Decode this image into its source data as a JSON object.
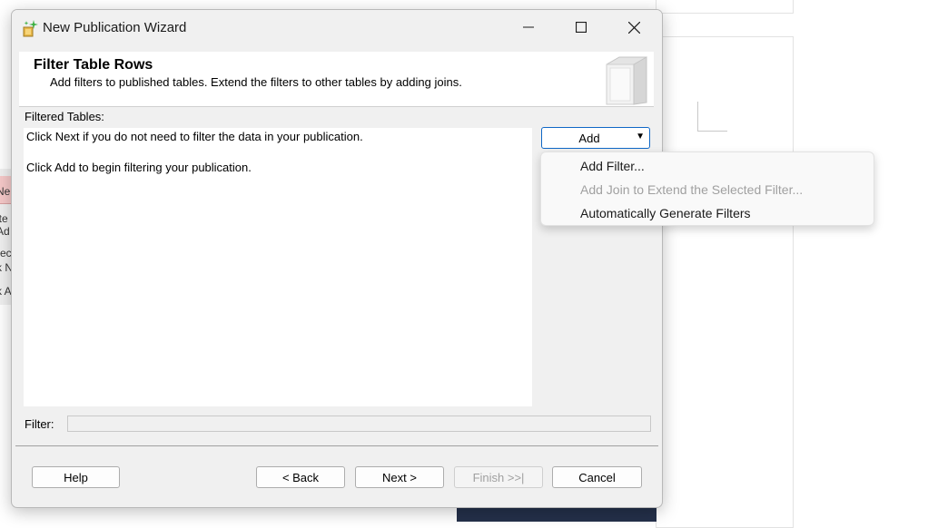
{
  "dialog": {
    "title": "New Publication Wizard",
    "header": {
      "title": "Filter Table Rows",
      "subtitle": "Add filters to published tables. Extend the filters to other tables by adding joins."
    },
    "filtered_tables_label": "Filtered Tables:",
    "tables_lines": [
      "Click Next if you do not need to filter the data in your publication.",
      "Click Add to begin filtering your publication."
    ],
    "add_button": {
      "label": "Add",
      "icon": "chevron-down-icon"
    },
    "filter_label": "Filter:",
    "filter_value": "",
    "buttons": {
      "help": "Help",
      "back": "< Back",
      "next": "Next >",
      "finish": "Finish >>|",
      "cancel": "Cancel"
    }
  },
  "add_menu": {
    "items": [
      {
        "label": "Add Filter...",
        "enabled": true
      },
      {
        "label": "Add Join to Extend the Selected Filter...",
        "enabled": false
      },
      {
        "label": "Automatically Generate Filters",
        "enabled": true
      }
    ]
  },
  "background": {
    "left_fragments": [
      "Ne",
      "lte",
      "Ad",
      "rec",
      "k N",
      "k A"
    ]
  },
  "colors": {
    "accent": "#0f67c6",
    "dialog_bg": "#f0f0f0",
    "disabled_text": "#a0a0a0"
  }
}
